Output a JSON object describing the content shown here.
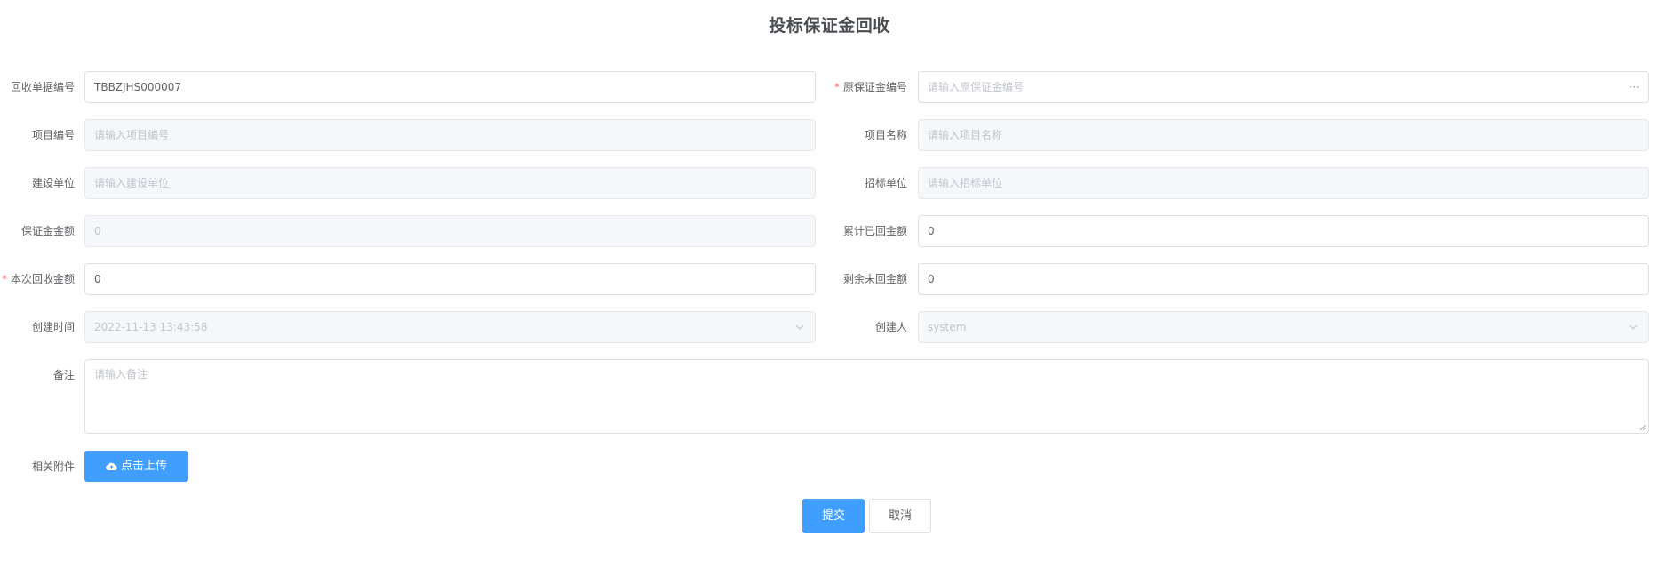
{
  "page": {
    "title": "投标保证金回收"
  },
  "form": {
    "recovery_no": {
      "label": "回收单据编号",
      "value": "TBBZJHS000007"
    },
    "original_deposit_no": {
      "label": "原保证金编号",
      "placeholder": "请输入原保证金编号",
      "suffix": "···"
    },
    "project_no": {
      "label": "项目编号",
      "placeholder": "请输入项目编号"
    },
    "project_name": {
      "label": "项目名称",
      "placeholder": "请输入项目名称"
    },
    "construction_unit": {
      "label": "建设单位",
      "placeholder": "请输入建设单位"
    },
    "tender_unit": {
      "label": "招标单位",
      "placeholder": "请输入招标单位"
    },
    "deposit_amount": {
      "label": "保证金金额",
      "value": "0"
    },
    "cumulative_recovered": {
      "label": "累计已回金额",
      "value": "0"
    },
    "current_recovery": {
      "label": "本次回收金额",
      "value": "0"
    },
    "remaining_unrecovered": {
      "label": "剩余未回金额",
      "value": "0"
    },
    "created_time": {
      "label": "创建时间",
      "value": "2022-11-13 13:43:58"
    },
    "creator": {
      "label": "创建人",
      "value": "system"
    },
    "remark": {
      "label": "备注",
      "placeholder": "请输入备注"
    },
    "attachments": {
      "label": "相关附件",
      "upload_label": "点击上传"
    }
  },
  "actions": {
    "submit_label": "提交",
    "cancel_label": "取消"
  },
  "colors": {
    "primary": "#409eff",
    "required": "#f56c6c",
    "border": "#dcdfe6",
    "disabled_bg": "#f5f7fa"
  }
}
